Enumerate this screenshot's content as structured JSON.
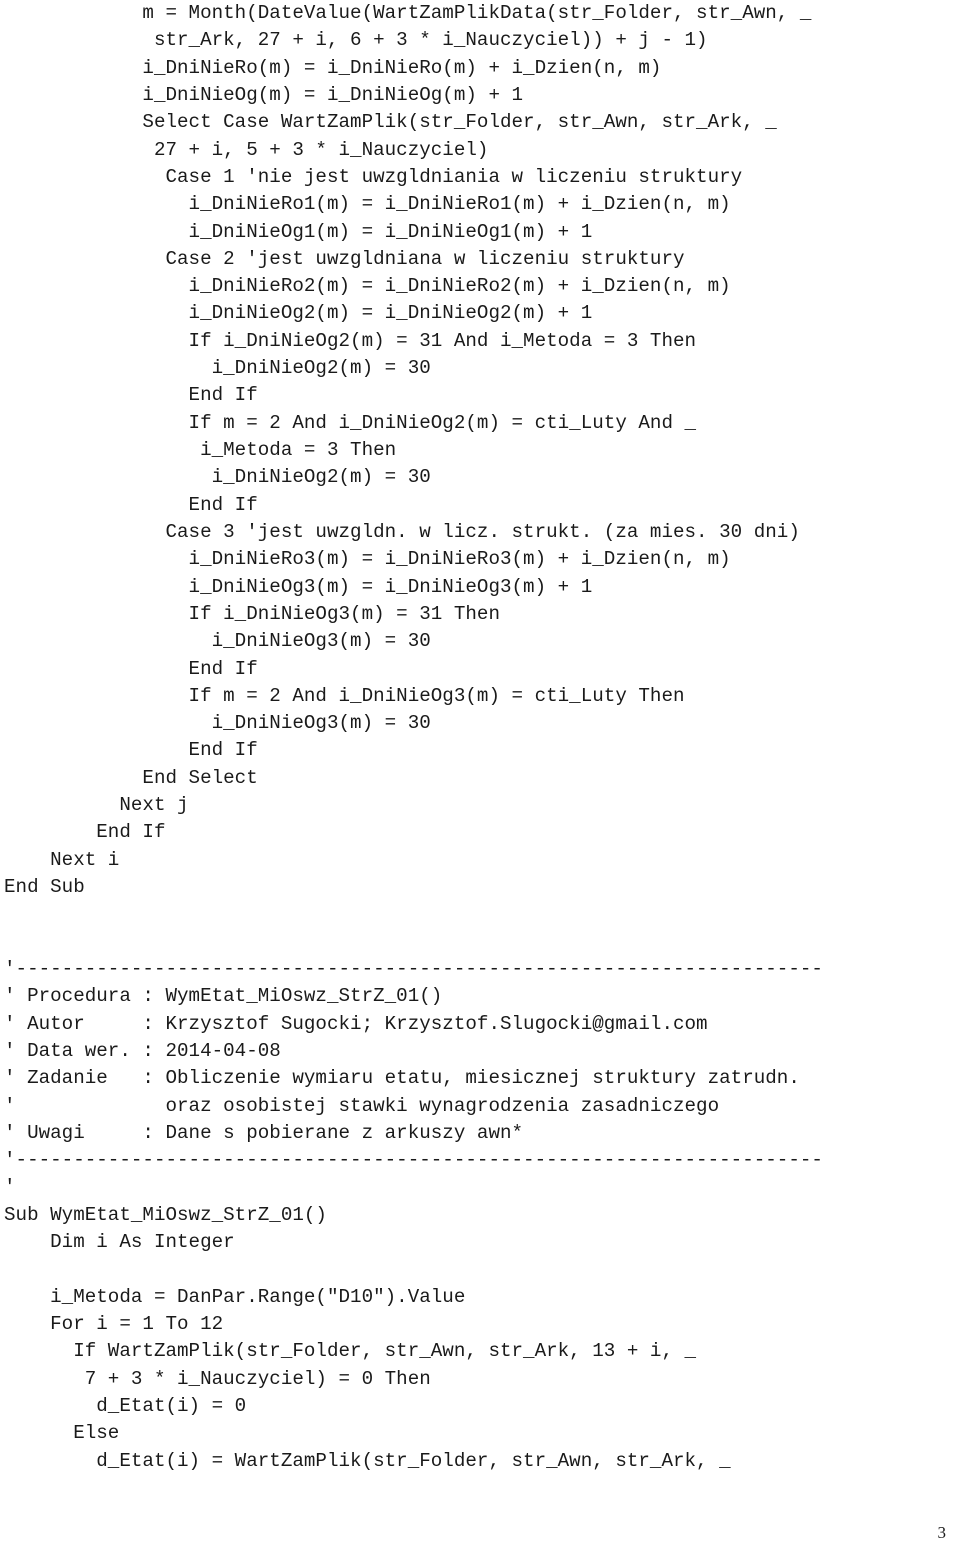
{
  "document": {
    "type": "vba-source-code-listing",
    "language": "VBA",
    "page_number": "3",
    "text_color": "#1a1a1a",
    "background_color": "#ffffff"
  },
  "code": {
    "lines": [
      "            m = Month(DateValue(WartZamPlikData(str_Folder, str_Awn, _",
      "             str_Ark, 27 + i, 6 + 3 * i_Nauczyciel)) + j - 1)",
      "            i_DniNieRo(m) = i_DniNieRo(m) + i_Dzien(n, m)",
      "            i_DniNieOg(m) = i_DniNieOg(m) + 1",
      "            Select Case WartZamPlik(str_Folder, str_Awn, str_Ark, _",
      "             27 + i, 5 + 3 * i_Nauczyciel)",
      "              Case 1 'nie jest uwzgldniania w liczeniu struktury",
      "                i_DniNieRo1(m) = i_DniNieRo1(m) + i_Dzien(n, m)",
      "                i_DniNieOg1(m) = i_DniNieOg1(m) + 1",
      "              Case 2 'jest uwzgldniana w liczeniu struktury",
      "                i_DniNieRo2(m) = i_DniNieRo2(m) + i_Dzien(n, m)",
      "                i_DniNieOg2(m) = i_DniNieOg2(m) + 1",
      "                If i_DniNieOg2(m) = 31 And i_Metoda = 3 Then",
      "                  i_DniNieOg2(m) = 30",
      "                End If",
      "                If m = 2 And i_DniNieOg2(m) = cti_Luty And _",
      "                 i_Metoda = 3 Then",
      "                  i_DniNieOg2(m) = 30",
      "                End If",
      "              Case 3 'jest uwzgldn. w licz. strukt. (za mies. 30 dni)",
      "                i_DniNieRo3(m) = i_DniNieRo3(m) + i_Dzien(n, m)",
      "                i_DniNieOg3(m) = i_DniNieOg3(m) + 1",
      "                If i_DniNieOg3(m) = 31 Then",
      "                  i_DniNieOg3(m) = 30",
      "                End If",
      "                If m = 2 And i_DniNieOg3(m) = cti_Luty Then",
      "                  i_DniNieOg3(m) = 30",
      "                End If",
      "            End Select",
      "          Next j",
      "        End If",
      "    Next i",
      "End Sub",
      "",
      "",
      "'----------------------------------------------------------------------",
      "' Procedura : WymEtat_MiOswz_StrZ_01()",
      "' Autor     : Krzysztof Sugocki; Krzysztof.Slugocki@gmail.com",
      "' Data wer. : 2014-04-08",
      "' Zadanie   : Obliczenie wymiaru etatu, miesicznej struktury zatrudn.",
      "'             oraz osobistej stawki wynagrodzenia zasadniczego",
      "' Uwagi     : Dane s pobierane z arkuszy awn*",
      "'----------------------------------------------------------------------",
      "'",
      "Sub WymEtat_MiOswz_StrZ_01()",
      "    Dim i As Integer",
      "",
      "    i_Metoda = DanPar.Range(\"D10\").Value",
      "    For i = 1 To 12",
      "      If WartZamPlik(str_Folder, str_Awn, str_Ark, 13 + i, _",
      "       7 + 3 * i_Nauczyciel) = 0 Then",
      "        d_Etat(i) = 0",
      "      Else",
      "        d_Etat(i) = WartZamPlik(str_Folder, str_Awn, str_Ark, _"
    ]
  },
  "footer": {
    "page_number": "3"
  }
}
